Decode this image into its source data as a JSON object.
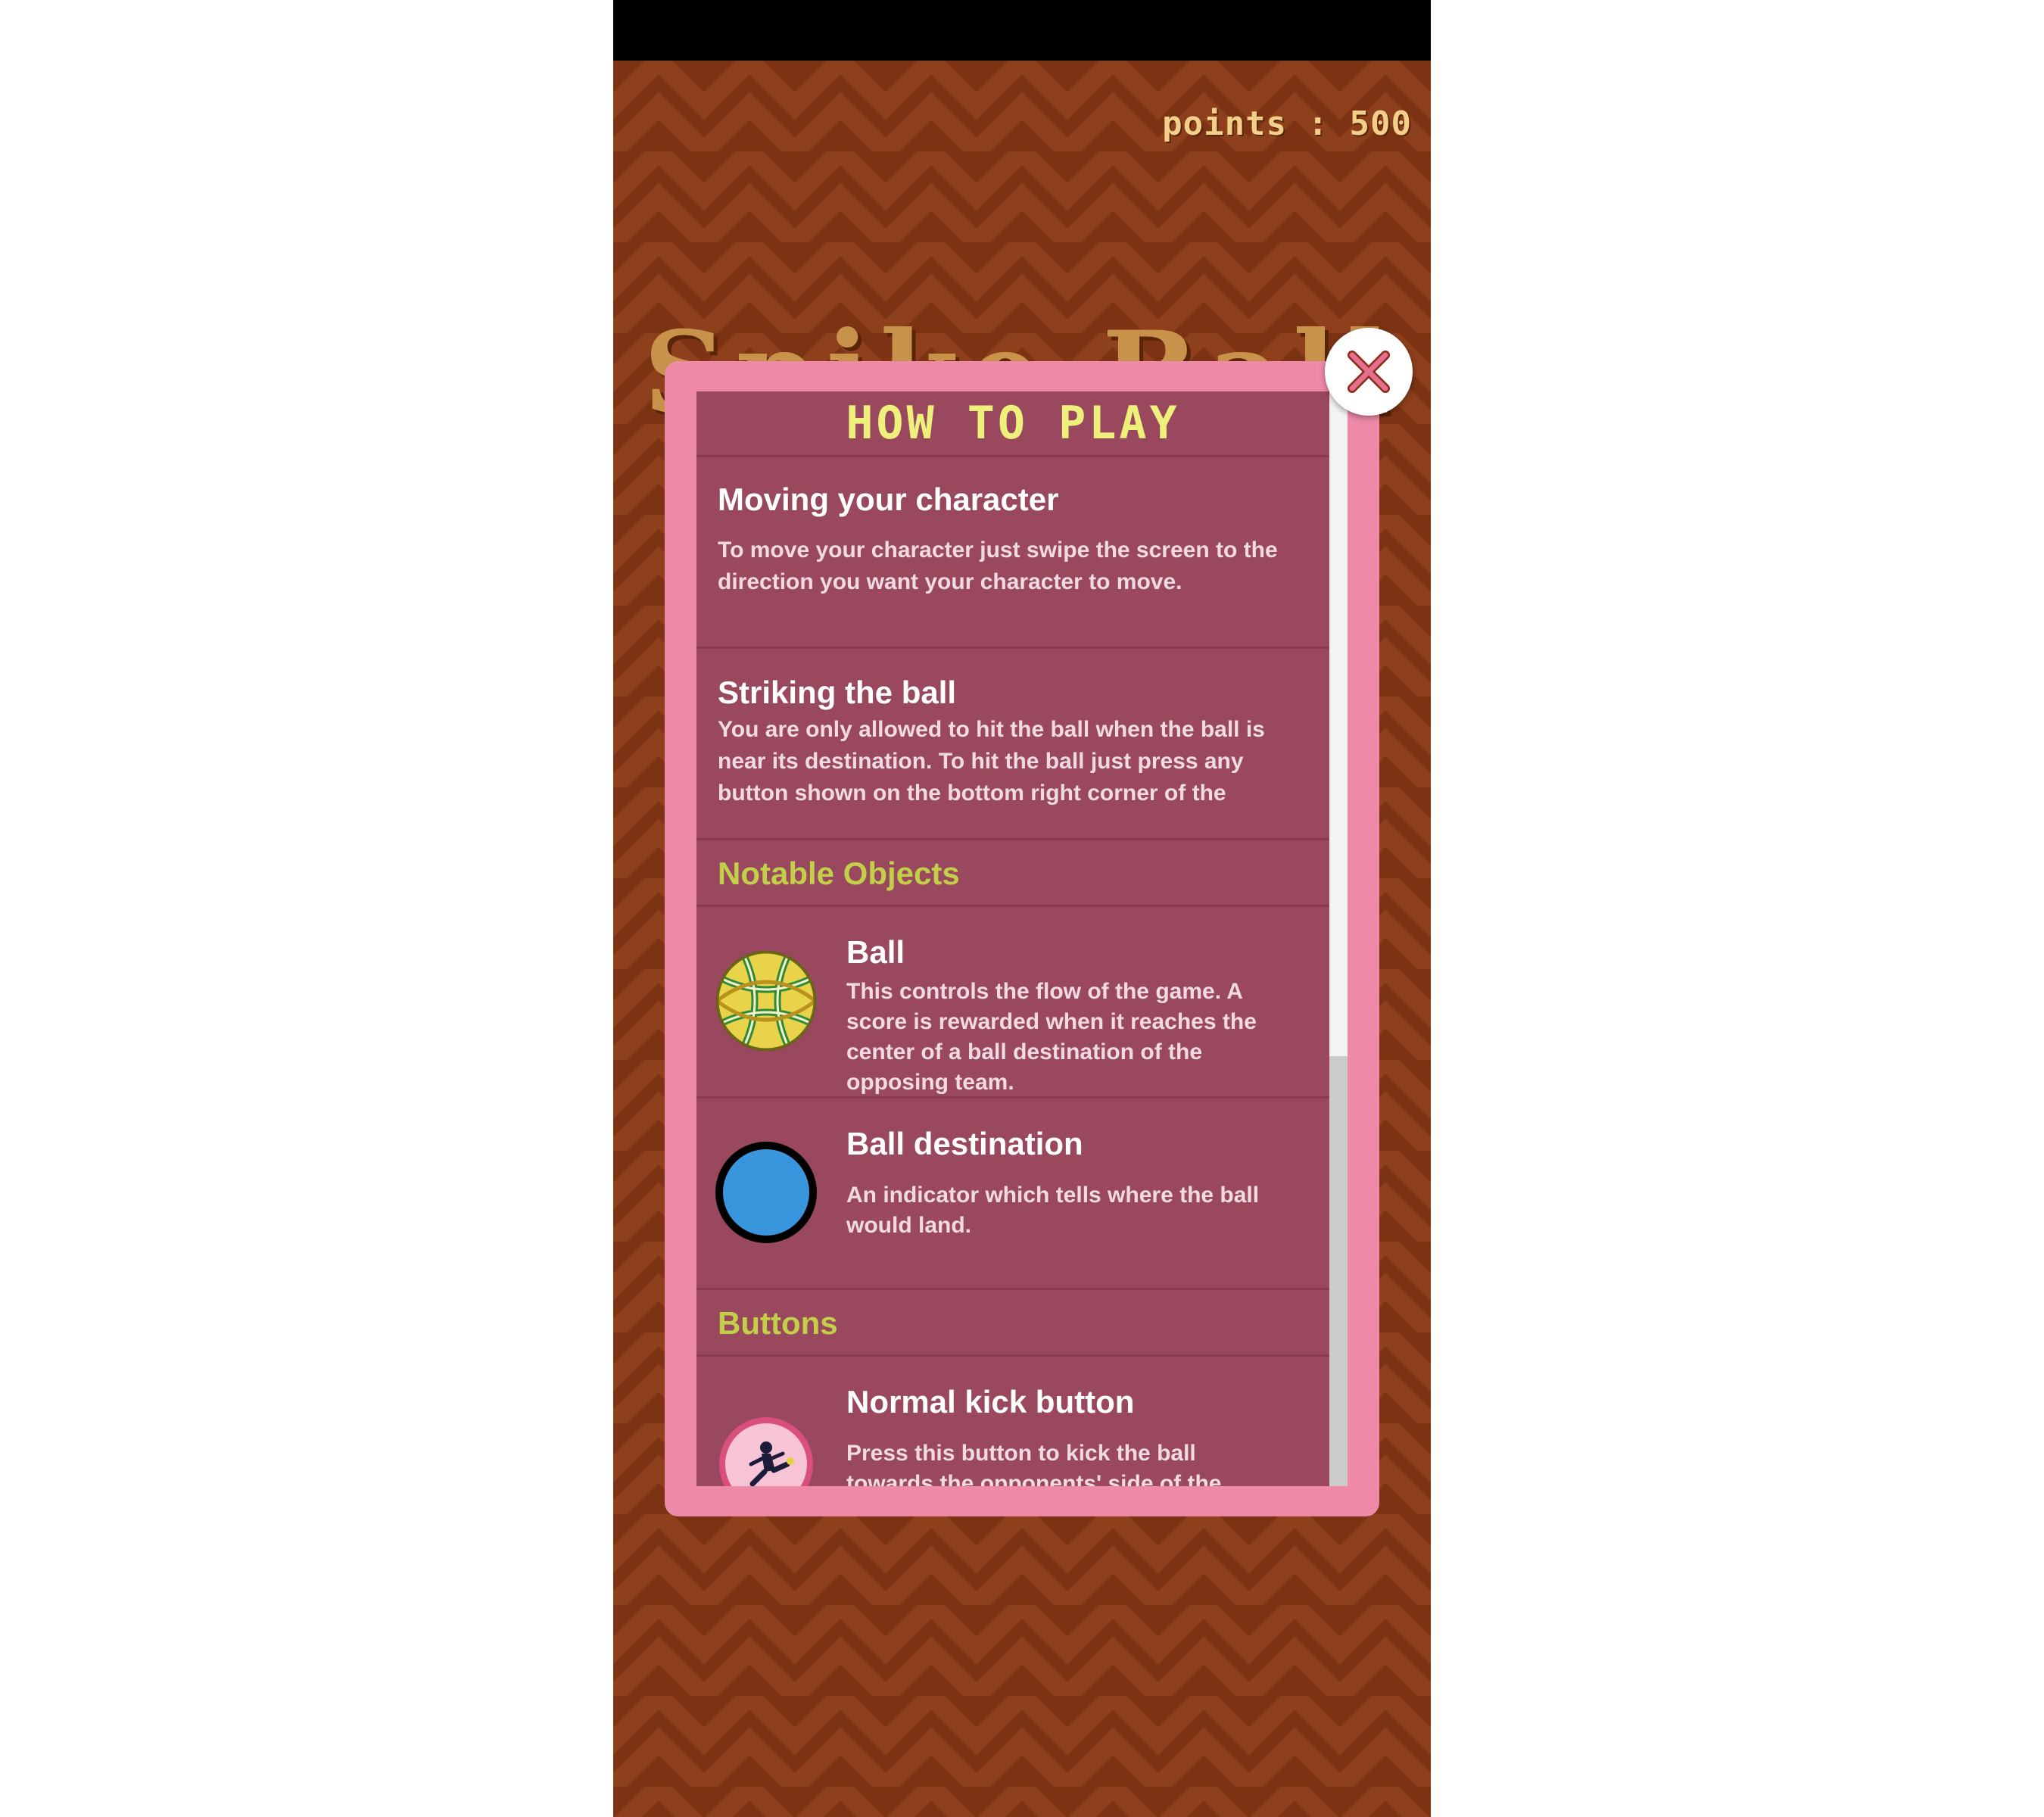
{
  "colors": {
    "background": "#7c3314",
    "modal_frame": "#ee8aa8",
    "modal_panel": "#99485e",
    "modal_title": "#eef07c",
    "category": "#c2cf48",
    "points_text": "#f3cf8a"
  },
  "hud": {
    "points_text": "points : 500"
  },
  "game": {
    "title": "Spike Ball"
  },
  "modal": {
    "title": "HOW TO PLAY",
    "close_icon": "close-x-icon",
    "sections": {
      "moving": {
        "heading": "Moving your character",
        "body": "To move your character just swipe the screen to the direction you want your character to move."
      },
      "striking": {
        "heading": "Striking the ball",
        "body": "You are only allowed to hit the ball when the ball is near its destination. To hit the ball just press any button shown on the bottom right corner of the"
      },
      "notable_objects": "Notable Objects",
      "ball": {
        "icon": "sepak-takraw-ball-icon",
        "heading": "Ball",
        "body": "This controls the flow of the game. A score is rewarded when it reaches the center of a ball destination of the opposing team."
      },
      "ball_destination": {
        "icon": "ball-destination-icon",
        "heading": "Ball destination",
        "body": "An indicator which tells where the ball would land."
      },
      "buttons": "Buttons",
      "normal_kick": {
        "icon": "kick-player-icon",
        "heading": "Normal kick button",
        "body": "Press this button to kick the ball towards the opponents' side of the"
      }
    }
  }
}
